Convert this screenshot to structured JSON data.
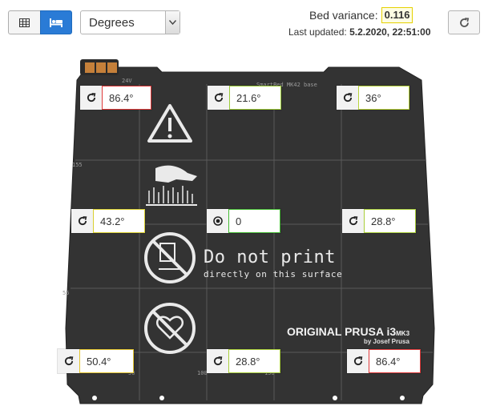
{
  "toolbar": {
    "table_view_icon": "table-icon",
    "bed_view_icon": "bed-icon",
    "unit_selected": "Degrees",
    "unit_options": [
      "Degrees"
    ],
    "variance_label": "Bed variance:",
    "variance_value": "0.116",
    "updated_label": "Last updated:",
    "updated_value": "5.2.2020, 22:51:00",
    "refresh_icon": "refresh-icon"
  },
  "bed": {
    "voltage_label": "24V",
    "header_text": "SmartBed MK42 base",
    "do_not_print": "Do not print",
    "do_not_print_sub": "directly on this surface",
    "brand_main": "ORIGINAL PRUSA i3",
    "brand_model": "MK3",
    "brand_by": "by Josef Prusa",
    "scale_155": "155",
    "scale_55": "55",
    "scale_50": "50",
    "scale_100": "100",
    "scale_150": "150"
  },
  "points": [
    {
      "value": "86.4°",
      "icon": "refresh-icon",
      "color": "#e03b3b"
    },
    {
      "value": "21.6°",
      "icon": "refresh-icon",
      "color": "#9ccc38"
    },
    {
      "value": "36°",
      "icon": "refresh-icon",
      "color": "#b8d43a"
    },
    {
      "value": "43.2°",
      "icon": "refresh-icon",
      "color": "#d9cf2f"
    },
    {
      "value": "0",
      "icon": "target-icon",
      "color": "#44bb33"
    },
    {
      "value": "28.8°",
      "icon": "refresh-icon",
      "color": "#a9cf3a"
    },
    {
      "value": "50.4°",
      "icon": "refresh-icon",
      "color": "#e3c530"
    },
    {
      "value": "28.8°",
      "icon": "refresh-icon",
      "color": "#a9cf3a"
    },
    {
      "value": "86.4°",
      "icon": "refresh-icon",
      "color": "#e03b3b"
    }
  ]
}
